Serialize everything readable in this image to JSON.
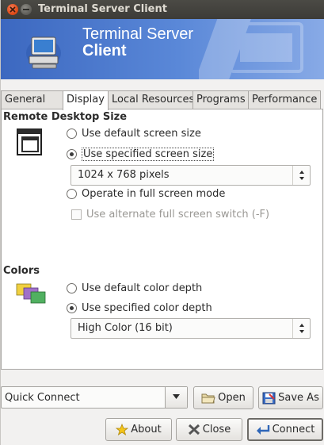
{
  "window": {
    "title": "Terminal Server Client"
  },
  "banner": {
    "line1": "Terminal Server",
    "line2": "Client"
  },
  "tabs": [
    {
      "label": "General"
    },
    {
      "label": "Display"
    },
    {
      "label": "Local Resources"
    },
    {
      "label": "Programs"
    },
    {
      "label": "Performance"
    }
  ],
  "active_tab": "Display",
  "remote_size": {
    "title": "Remote Desktop Size",
    "opt_default": "Use default screen size",
    "opt_specified": "Use specified screen size",
    "selected": "Use specified screen size",
    "size_value": "1024 x 768 pixels",
    "opt_fullscreen": "Operate in full screen mode",
    "alt_switch": "Use alternate full screen switch (-F)",
    "alt_switch_checked": false,
    "alt_switch_enabled": false
  },
  "colors": {
    "title": "Colors",
    "opt_default": "Use default color depth",
    "opt_specified": "Use specified color depth",
    "selected": "Use specified color depth",
    "depth_value": "High Color (16 bit)"
  },
  "bottom": {
    "quick_connect": "Quick Connect",
    "open": "Open",
    "save_as": "Save As",
    "about": "About",
    "close": "Close",
    "connect": "Connect"
  },
  "icons": {
    "close": "close-icon",
    "minimize": "minimize-icon",
    "app": "computer-icon",
    "screen": "screen-size-icon",
    "colors": "color-depth-icon",
    "open": "folder-icon",
    "save": "save-icon",
    "about": "star-icon",
    "close_btn": "close-x-icon",
    "connect": "connect-arrow-icon"
  },
  "colors_theme": {
    "titlebar": "#3c3b37",
    "banner": "#4a78cc",
    "close": "#df4a16"
  }
}
